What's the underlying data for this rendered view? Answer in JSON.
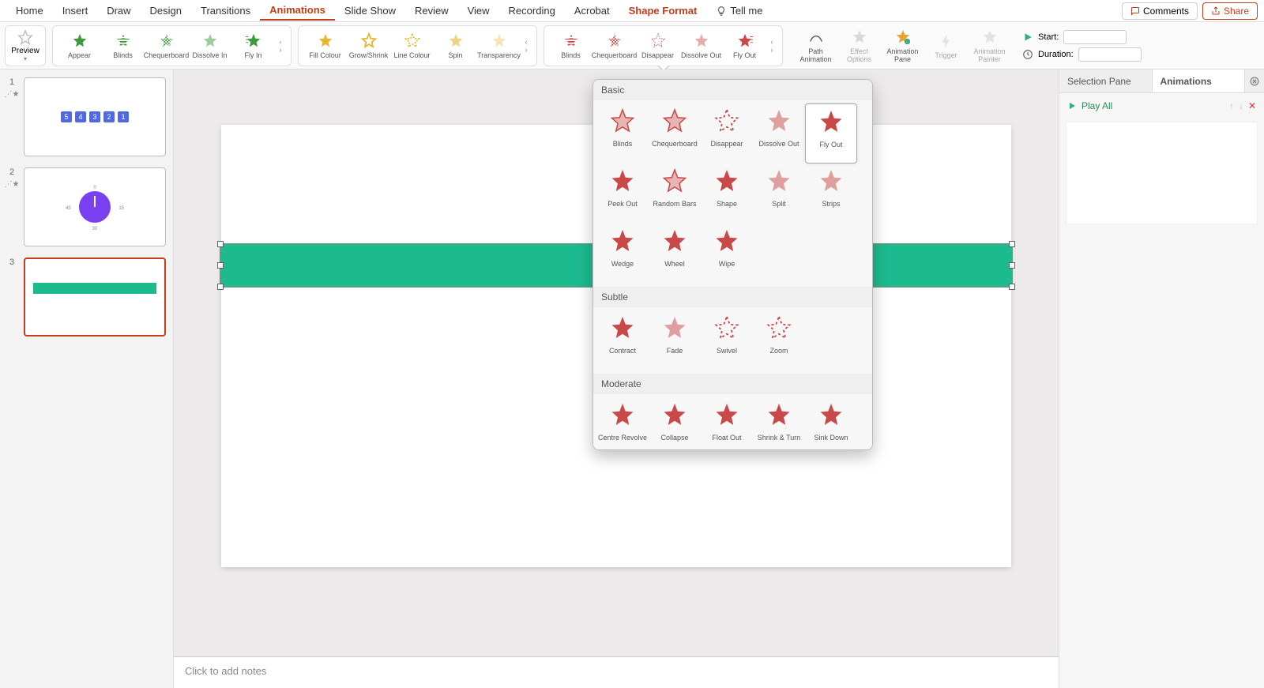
{
  "menu": {
    "tabs": [
      "Home",
      "Insert",
      "Draw",
      "Design",
      "Transitions",
      "Animations",
      "Slide Show",
      "Review",
      "View",
      "Recording",
      "Acrobat",
      "Shape Format"
    ],
    "active": "Animations",
    "highlight": "Shape Format",
    "tellMe": "Tell me",
    "comments": "Comments",
    "share": "Share"
  },
  "ribbon": {
    "preview": "Preview",
    "entrance": [
      "Appear",
      "Blinds",
      "Chequerboard",
      "Dissolve In",
      "Fly In"
    ],
    "emphasis": [
      "Fill Colour",
      "Grow/Shrink",
      "Line Colour",
      "Spin",
      "Transparency"
    ],
    "exit": [
      "Blinds",
      "Chequerboard",
      "Disappear",
      "Dissolve Out",
      "Fly Out"
    ],
    "tools": [
      "Path Animation",
      "Effect Options",
      "Animation Pane",
      "Trigger",
      "Animation Painter"
    ],
    "startLabel": "Start:",
    "durationLabel": "Duration:",
    "startValue": "",
    "durationValue": ""
  },
  "slides": {
    "s1_chips": [
      "5",
      "4",
      "3",
      "2",
      "1"
    ],
    "s2_clock": {
      "top": "0",
      "right": "15",
      "bottom": "30",
      "left": "45"
    }
  },
  "notes": "Click to add notes",
  "rightPane": {
    "tab1": "Selection Pane",
    "tab2": "Animations",
    "playAll": "Play All"
  },
  "gallery": {
    "sections": [
      {
        "title": "Basic",
        "items": [
          "Blinds",
          "Chequerboard",
          "Disappear",
          "Dissolve Out",
          "Fly Out",
          "Peek Out",
          "Random Bars",
          "Shape",
          "Split",
          "Strips",
          "Wedge",
          "Wheel",
          "Wipe"
        ],
        "selected": "Fly Out"
      },
      {
        "title": "Subtle",
        "items": [
          "Contract",
          "Fade",
          "Swivel",
          "Zoom"
        ]
      },
      {
        "title": "Moderate",
        "items": [
          "Centre Revolve",
          "Collapse",
          "Float Out",
          "Shrink & Turn",
          "Sink Down"
        ]
      }
    ]
  },
  "colors": {
    "entrance": "#3b9b3b",
    "emphasis": "#d6a31a",
    "exit": "#c94848",
    "accent": "#c43e1c",
    "shape": "#1dba8e"
  }
}
